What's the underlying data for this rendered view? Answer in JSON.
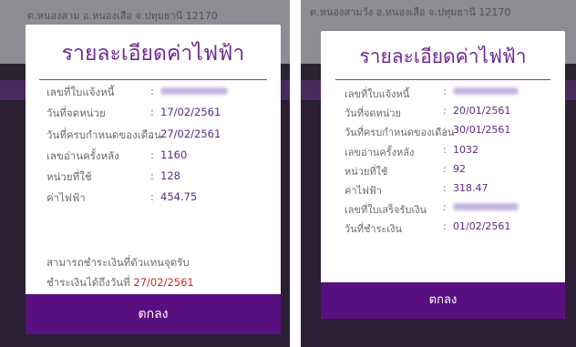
{
  "left": {
    "title": "รายละเอียดค่าไฟฟ้า",
    "rows": [
      {
        "label": "เลขที่ใบแจ้งหนี้",
        "value": ""
      },
      {
        "label": "วันที่จดหน่วย",
        "value": "17/02/2561"
      },
      {
        "label": "วันที่ครบกำหนดของเดือน",
        "value": "27/02/2561"
      },
      {
        "label": "เลขอ่านครั้งหลัง",
        "value": "1160"
      },
      {
        "label": "หน่วยที่ใช้",
        "value": "128"
      },
      {
        "label": "ค่าไฟฟ้า",
        "value": "454.75"
      }
    ],
    "note_line1": "สามารถชำระเงินที่ตัวแทนจุดรับ",
    "note_line2": "ชำระเงินได้ถึงวันที่ ",
    "note_date": "27/02/2561",
    "ok_label": "ตกลง"
  },
  "right": {
    "title": "รายละเอียดค่าไฟฟ้า",
    "rows": [
      {
        "label": "เลขที่ใบแจ้งหนี้",
        "value": ""
      },
      {
        "label": "วันที่จดหน่วย",
        "value": "20/01/2561"
      },
      {
        "label": "วันที่ครบกำหนดของเดือน",
        "value": "30/01/2561"
      },
      {
        "label": "เลขอ่านครั้งหลัง",
        "value": "1032"
      },
      {
        "label": "หน่วยที่ใช้",
        "value": "92"
      },
      {
        "label": "ค่าไฟฟ้า",
        "value": "318.47"
      },
      {
        "label": "เลขที่ใบเสร็จรับเงิน",
        "value": ""
      },
      {
        "label": "วันที่ชำระเงิน",
        "value": "01/02/2561"
      }
    ],
    "ok_label": "ตกลง"
  },
  "colon": ":",
  "background_text": {
    "left_line": "ต.หนองสาม อ.หนองเสือ จ.ปทุมธานี 12170",
    "right_line": "ต.หนองสามวัง อ.หนองเสือ จ.ปทุมธานี 12170"
  },
  "colors": {
    "accent": "#6b2a8f",
    "ok_bar": "#5a0f80",
    "due_date": "#d42424"
  }
}
